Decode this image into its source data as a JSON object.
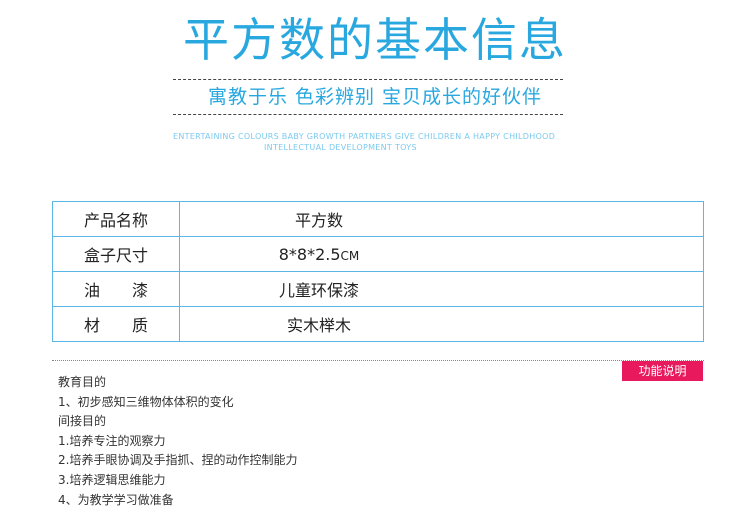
{
  "header": {
    "title": "平方数的基本信息",
    "slogan": "寓教于乐  色彩辨别  宝贝成长的好伙伴",
    "english_line1": "ENTERTAINING COLOURS BABY GROWTH PARTNERS GIVE CHILDREN A HAPPY CHILDHOOD",
    "english_line2": "INTELLECTUAL DEVELOPMENT TOYS"
  },
  "product_table": {
    "rows": [
      {
        "label": "产品名称",
        "value": "平方数",
        "unit": ""
      },
      {
        "label": "盒子尺寸",
        "value": "8*8*2.5",
        "unit": "CM"
      },
      {
        "label": "油　　漆",
        "value": "儿童环保漆",
        "unit": ""
      },
      {
        "label": "材　　质",
        "value": "实木榉木",
        "unit": ""
      }
    ]
  },
  "function_section": {
    "badge": "功能说明",
    "lines": [
      "教育目的",
      "1、初步感知三维物体体积的变化",
      "间接目的",
      "1.培养专注的观察力",
      "2.培养手眼协调及手指抓、捏的动作控制能力",
      "3.培养逻辑思维能力",
      "4、为教学学习做准备"
    ]
  },
  "colors": {
    "accent_blue": "#29a8e0",
    "badge_pink": "#e8195d",
    "table_border": "#5bb8e6"
  }
}
